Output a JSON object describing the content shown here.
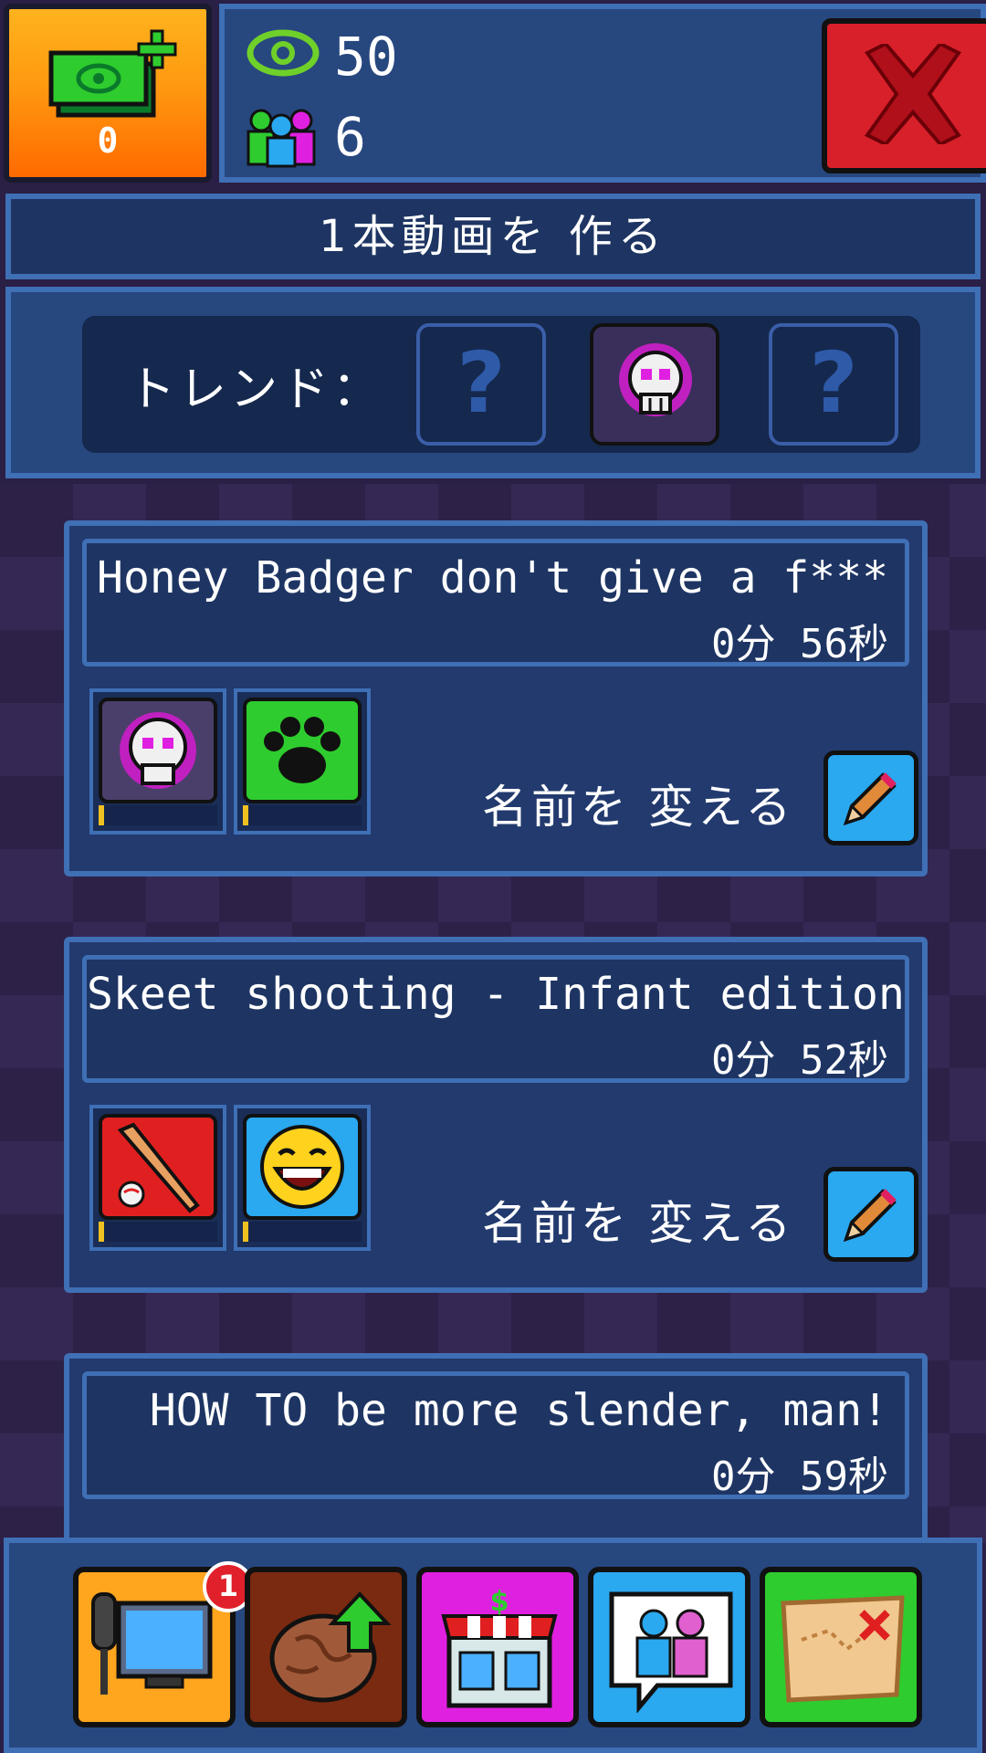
{
  "header": {
    "cash_value": "0",
    "views_value": "50",
    "subscribers_value": "6"
  },
  "make_video": {
    "label": "1本動画を 作る"
  },
  "trends": {
    "label": "トレンド：",
    "slots": [
      "?",
      "skull-icon",
      "?"
    ]
  },
  "videos": [
    {
      "title": "Honey Badger don't give a f***",
      "duration": "0分 56秒",
      "tags": [
        "skull-icon",
        "paw-icon"
      ],
      "rename_label": "名前を 変える"
    },
    {
      "title": "Skeet shooting - Infant edition",
      "duration": "0分 52秒",
      "tags": [
        "cricket-bat-icon",
        "laughing-face-icon"
      ],
      "rename_label": "名前を 変える"
    },
    {
      "title": "HOW TO be more slender, man!",
      "duration": "0分 59秒"
    }
  ],
  "bottom_nav": {
    "items": [
      "studio-icon",
      "brain-upgrade-icon",
      "shop-icon",
      "community-icon",
      "map-icon"
    ],
    "studio_badge": "1"
  },
  "colors": {
    "accent_blue": "#3f6fb5",
    "cash_orange": "#ff9a10",
    "close_red": "#d8202a",
    "paw_green": "#2ecc2e",
    "pink": "#e020e0"
  }
}
